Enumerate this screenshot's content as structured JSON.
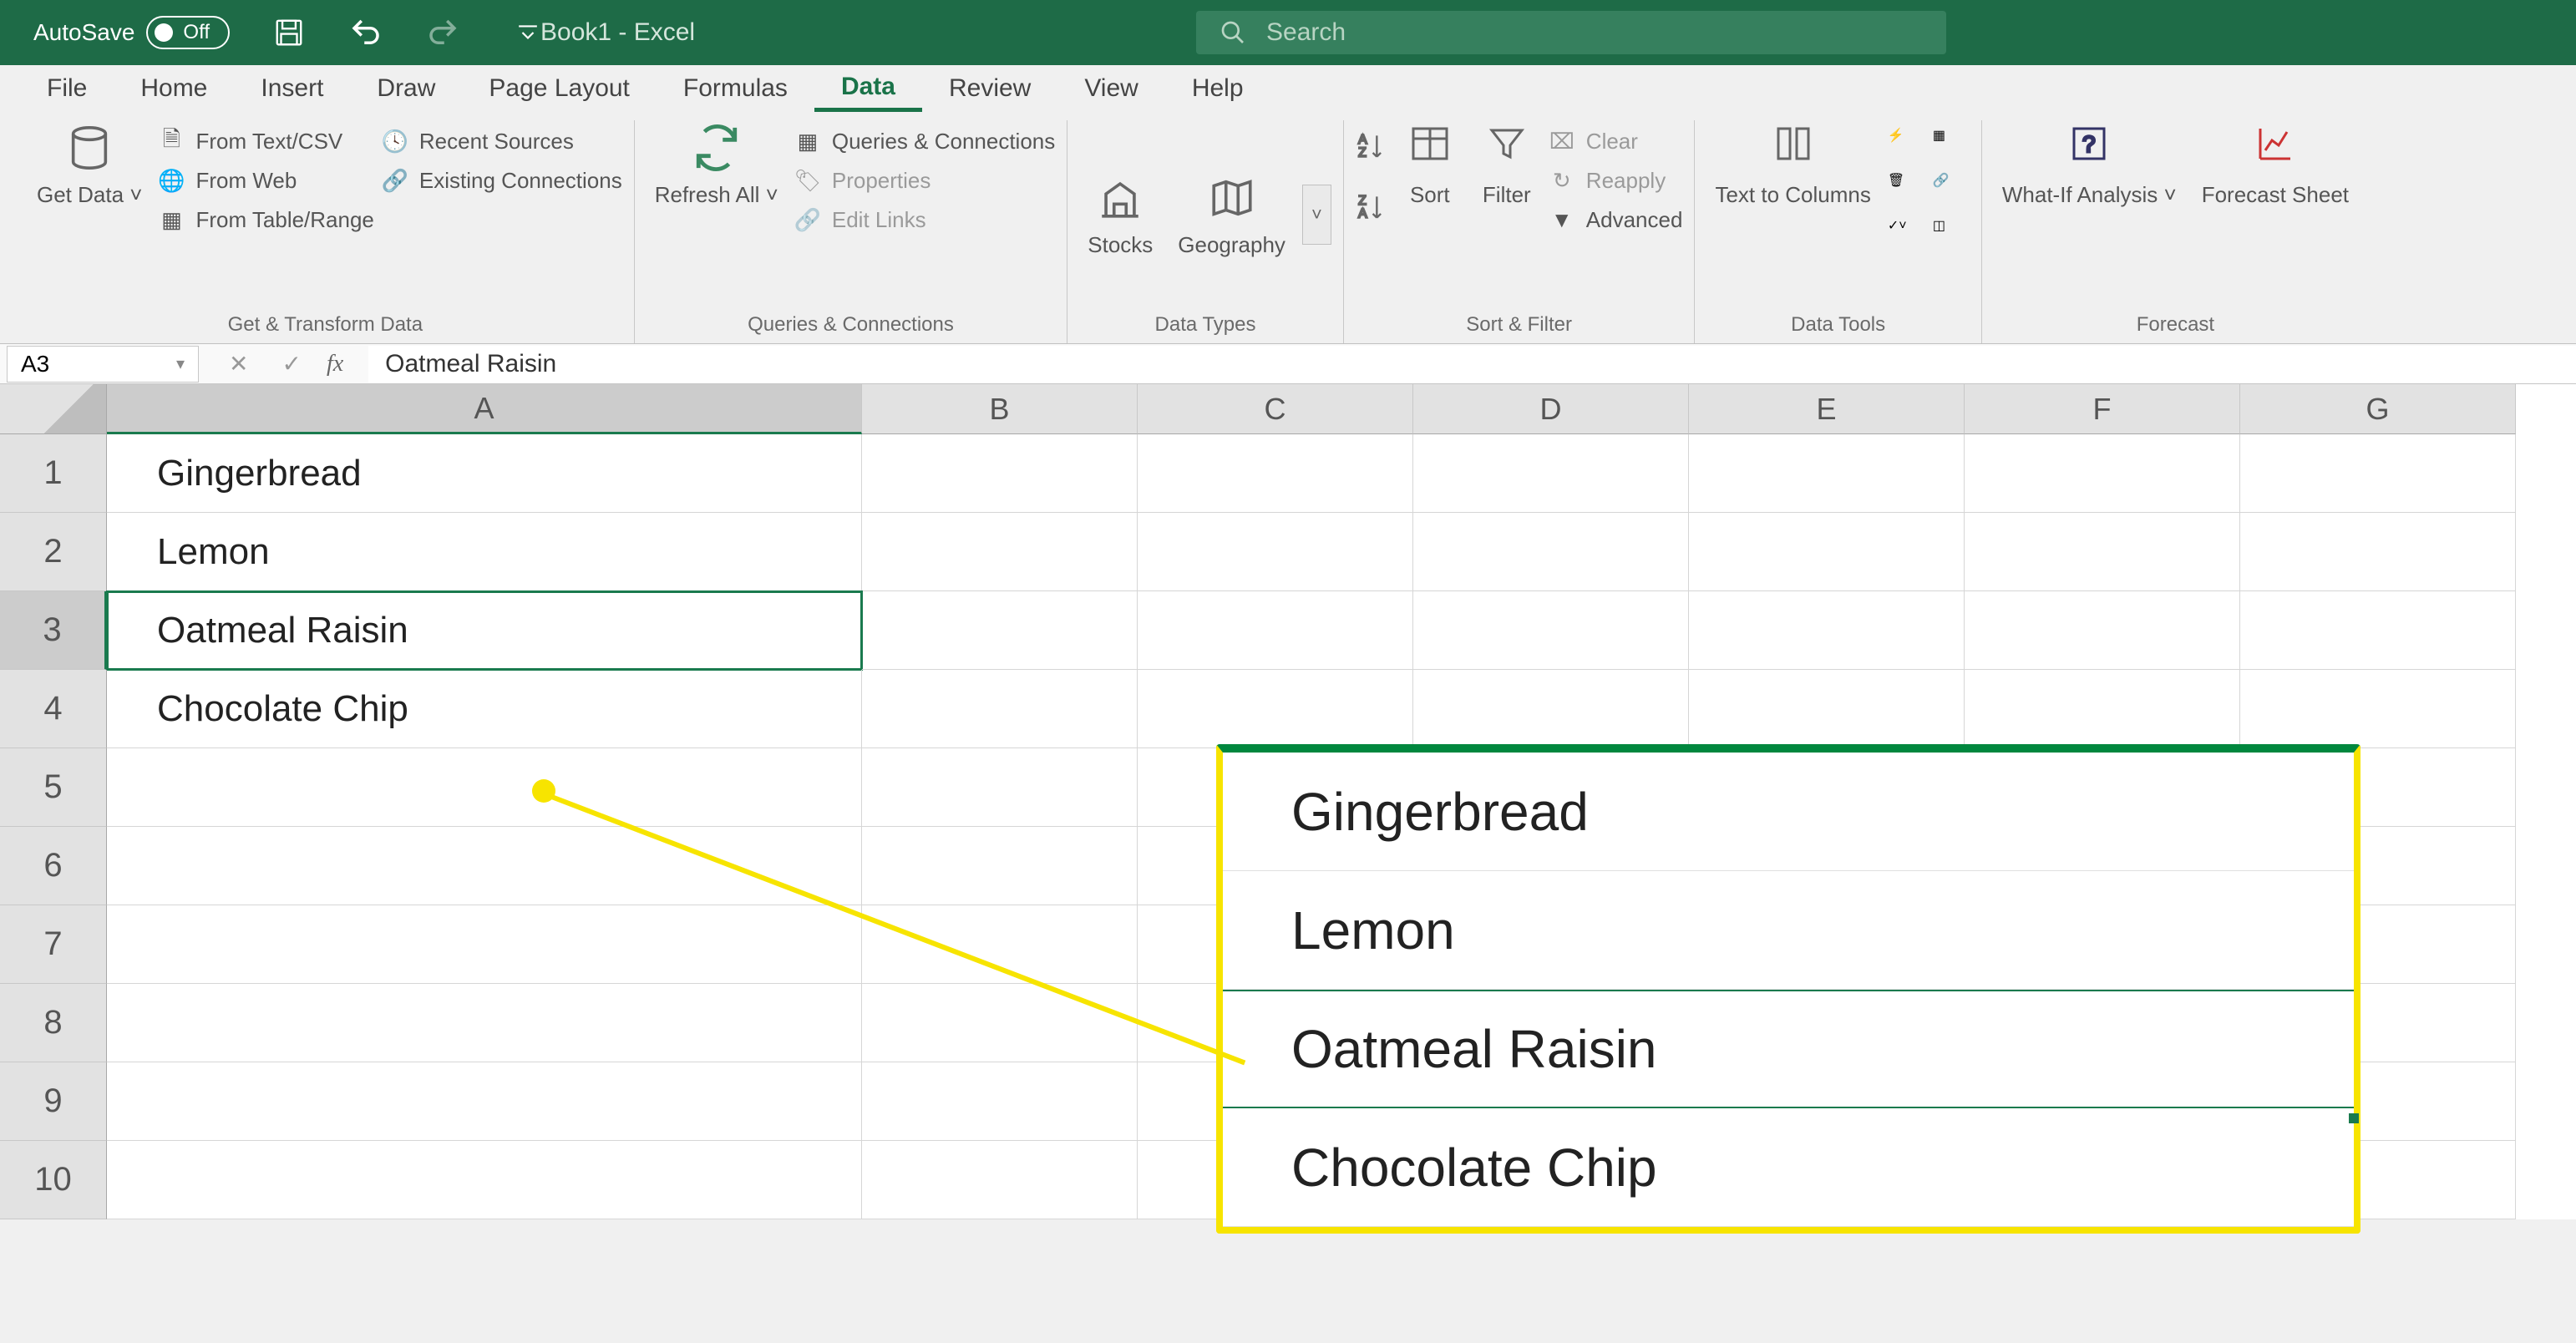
{
  "titlebar": {
    "autosave_label": "AutoSave",
    "autosave_state": "Off",
    "book_title": "Book1  -  Excel",
    "search_placeholder": "Search"
  },
  "tabs": [
    "File",
    "Home",
    "Insert",
    "Draw",
    "Page Layout",
    "Formulas",
    "Data",
    "Review",
    "View",
    "Help"
  ],
  "active_tab": "Data",
  "ribbon": {
    "get_transform": {
      "get_data": "Get Data",
      "from_text_csv": "From Text/CSV",
      "from_web": "From Web",
      "from_table_range": "From Table/Range",
      "recent_sources": "Recent Sources",
      "existing_connections": "Existing Connections",
      "group_label": "Get & Transform Data"
    },
    "queries": {
      "refresh_all": "Refresh All",
      "queries_connections": "Queries & Connections",
      "properties": "Properties",
      "edit_links": "Edit Links",
      "group_label": "Queries & Connections"
    },
    "data_types": {
      "stocks": "Stocks",
      "geography": "Geography",
      "group_label": "Data Types"
    },
    "sort_filter": {
      "sort": "Sort",
      "filter": "Filter",
      "clear": "Clear",
      "reapply": "Reapply",
      "advanced": "Advanced",
      "group_label": "Sort & Filter"
    },
    "data_tools": {
      "text_to_columns": "Text to Columns",
      "group_label": "Data Tools"
    },
    "forecast": {
      "what_if": "What-If Analysis",
      "forecast_sheet": "Forecast Sheet",
      "group_label": "Forecast"
    }
  },
  "formula_bar": {
    "name_box": "A3",
    "formula": "Oatmeal Raisin"
  },
  "grid": {
    "columns": [
      "A",
      "B",
      "C",
      "D",
      "E",
      "F",
      "G"
    ],
    "rows": [
      1,
      2,
      3,
      4,
      5,
      6,
      7,
      8,
      9,
      10
    ],
    "active_cell": "A3",
    "data": {
      "A1": "Gingerbread",
      "A2": "Lemon",
      "A3": "Oatmeal Raisin",
      "A4": "Chocolate Chip"
    }
  },
  "callout": {
    "items": [
      "Gingerbread",
      "Lemon",
      "Oatmeal Raisin",
      "Chocolate Chip"
    ]
  }
}
